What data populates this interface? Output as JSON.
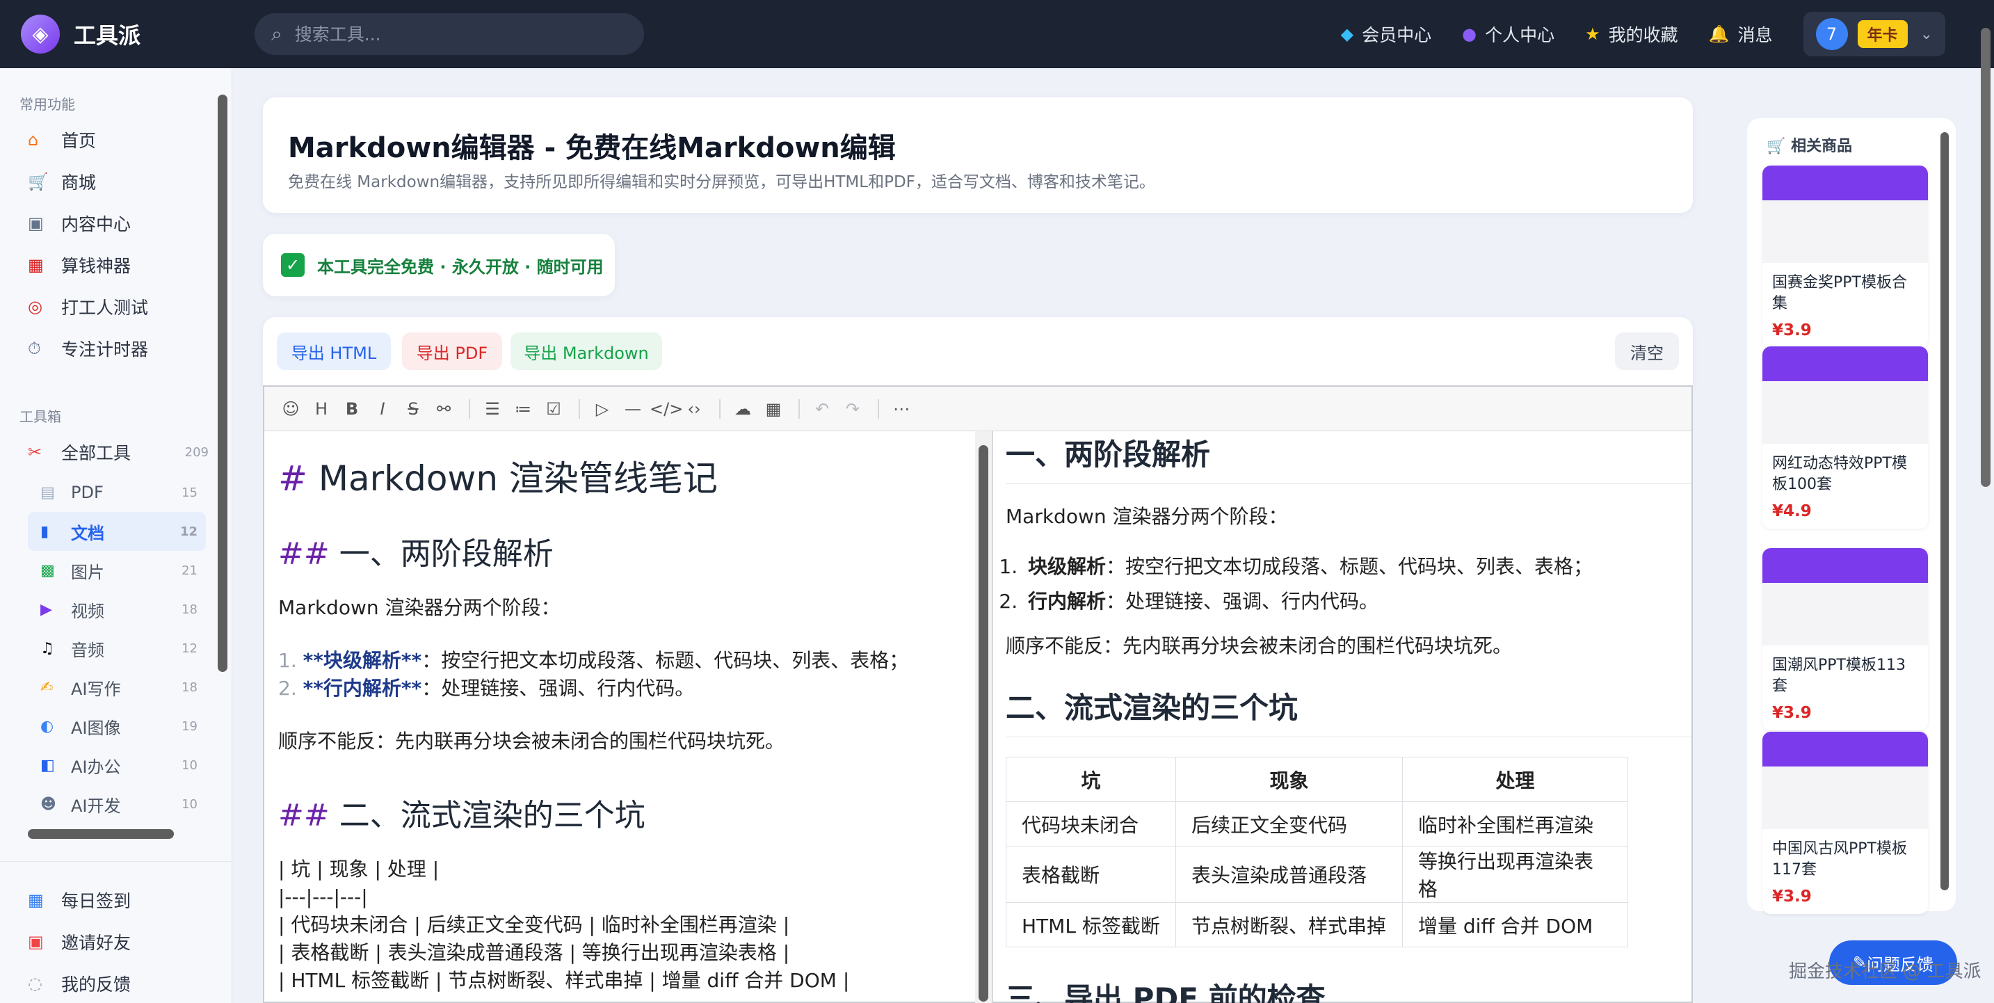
{
  "brand": {
    "name": "工具派",
    "logo_icon": "bag-icon"
  },
  "search": {
    "placeholder": "搜索工具..."
  },
  "nav": [
    {
      "label": "会员中心",
      "icon": "diamond-icon"
    },
    {
      "label": "个人中心",
      "icon": "user-icon"
    },
    {
      "label": "我的收藏",
      "icon": "star-icon"
    },
    {
      "label": "消息",
      "icon": "bell-icon"
    }
  ],
  "user": {
    "avatar": "7",
    "badge": "年卡"
  },
  "sidebar": {
    "common_title": "常用功能",
    "common": [
      {
        "label": "首页"
      },
      {
        "label": "商城"
      },
      {
        "label": "内容中心"
      },
      {
        "label": "算钱神器"
      },
      {
        "label": "打工人测试"
      },
      {
        "label": "专注计时器"
      }
    ],
    "tools_title": "工具箱",
    "all_tools": {
      "label": "全部工具",
      "count": "209"
    },
    "tools": [
      {
        "label": "PDF",
        "count": "15"
      },
      {
        "label": "文档",
        "count": "12"
      },
      {
        "label": "图片",
        "count": "21"
      },
      {
        "label": "视频",
        "count": "18"
      },
      {
        "label": "音频",
        "count": "12"
      },
      {
        "label": "AI写作",
        "count": "18"
      },
      {
        "label": "AI图像",
        "count": "19"
      },
      {
        "label": "AI办公",
        "count": "10"
      },
      {
        "label": "AI开发",
        "count": "10"
      }
    ],
    "bottom": [
      {
        "label": "每日签到"
      },
      {
        "label": "邀请好友"
      },
      {
        "label": "我的反馈"
      }
    ]
  },
  "page": {
    "title": "Markdown编辑器 - 免费在线Markdown编辑",
    "subtitle": "免费在线 Markdown编辑器，支持所见即所得编辑和实时分屏预览，可导出HTML和PDF，适合写文档、博客和技术笔记。",
    "free_notice": "本工具完全免费 · 永久开放 · 随时可用"
  },
  "actions": {
    "export_html": "导出 HTML",
    "export_pdf": "导出 PDF",
    "export_md": "导出 Markdown",
    "clear": "清空"
  },
  "source": {
    "h1_hash": "#",
    "h1": "Markdown 渲染管线笔记",
    "h2a_hash": "##",
    "h2a": "一、两阶段解析",
    "p1": "Markdown 渲染器分两个阶段：",
    "li1_num": "1.",
    "li1_bold": "**块级解析**",
    "li1_rest": "：按空行把文本切成段落、标题、代码块、列表、表格；",
    "li2_num": "2.",
    "li2_bold": "**行内解析**",
    "li2_rest": "：处理链接、强调、行内代码。",
    "p2": "顺序不能反：先内联再分块会被未闭合的围栏代码块坑死。",
    "h2b_hash": "##",
    "h2b": "二、流式渲染的三个坑",
    "t1": "| 坑 | 现象 | 处理 |",
    "t2": "|---|---|---|",
    "t3": "| 代码块未闭合 | 后续正文全变代码 | 临时补全围栏再渲染 |",
    "t4": "| 表格截断 | 表头渲染成普通段落 | 等换行出现再渲染表格 |",
    "t5": "| HTML 标签截断 | 节点树断裂、样式串掉 | 增量 diff 合并 DOM |"
  },
  "preview": {
    "h2a": "一、两阶段解析",
    "p1": "Markdown 渲染器分两个阶段：",
    "li1_bold": "块级解析",
    "li1_rest": "：按空行把文本切成段落、标题、代码块、列表、表格；",
    "li2_bold": "行内解析",
    "li2_rest": "：处理链接、强调、行内代码。",
    "p2": "顺序不能反：先内联再分块会被未闭合的围栏代码块坑死。",
    "h2b": "二、流式渲染的三个坑",
    "table": {
      "headers": [
        "坑",
        "现象",
        "处理"
      ],
      "rows": [
        [
          "代码块未闭合",
          "后续正文全变代码",
          "临时补全围栏再渲染"
        ],
        [
          "表格截断",
          "表头渲染成普通段落",
          "等换行出现再渲染表格"
        ],
        [
          "HTML 标签截断",
          "节点树断裂、样式串掉",
          "增量 diff 合并 DOM"
        ]
      ]
    },
    "h2c": "三、导出 PDF 前的检查"
  },
  "rail": {
    "title": "相关商品",
    "products": [
      {
        "name": "国赛金奖PPT模板合集",
        "price": "¥3.9"
      },
      {
        "name": "网红动态特效PPT模板100套",
        "price": "¥4.9"
      },
      {
        "name": "国潮风PPT模板113套",
        "price": "¥3.9"
      },
      {
        "name": "中国风古风PPT模板117套",
        "price": "¥3.9"
      }
    ]
  },
  "feedback": "问题反馈",
  "watermark": "掘金技术社区 @ 工具派"
}
